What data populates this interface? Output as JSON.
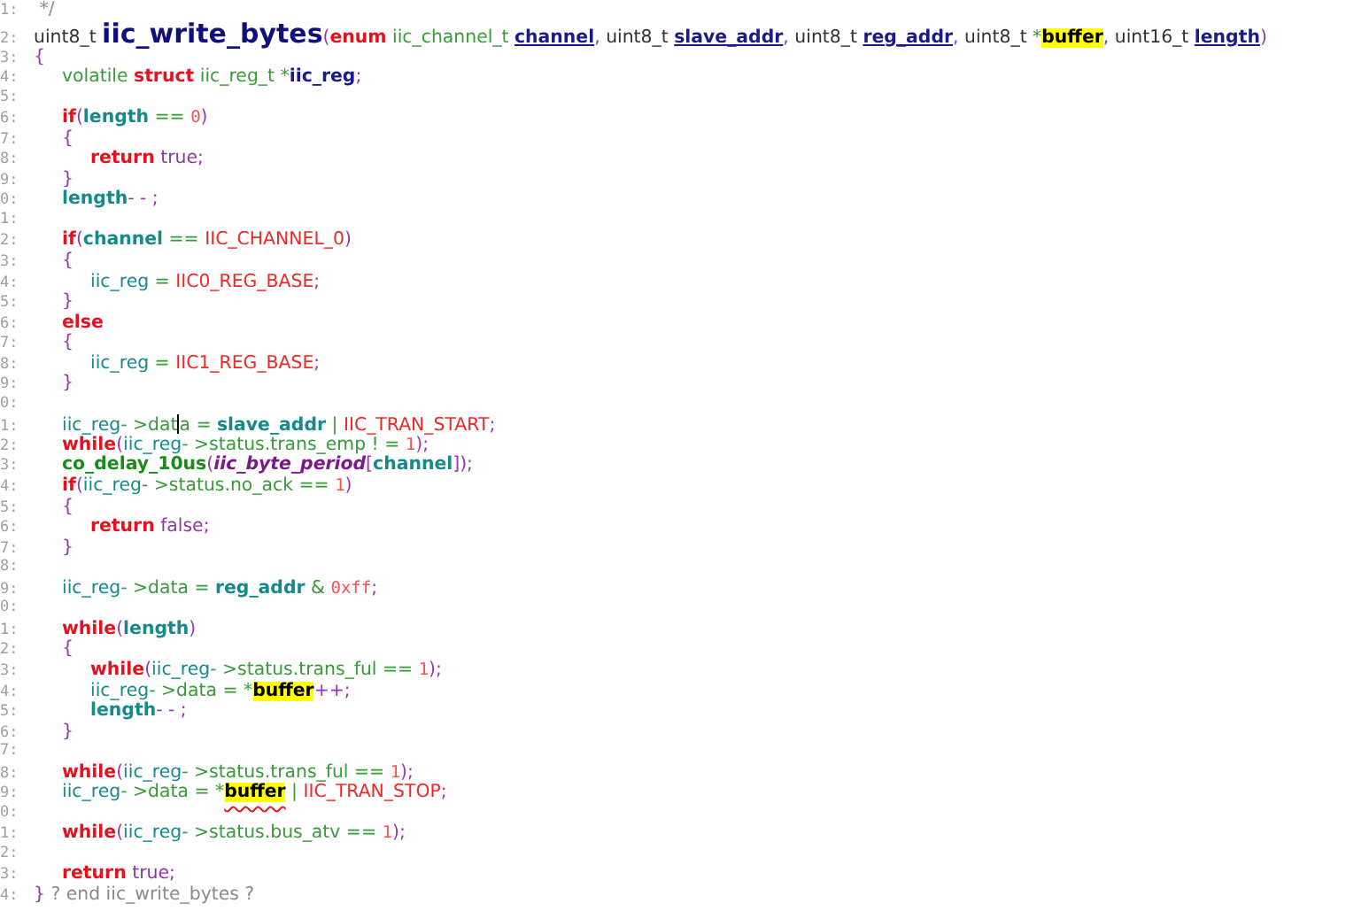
{
  "editor": {
    "lines": [
      {
        "number": "1:",
        "tokens": [
          {
            "kind": "comment",
            "text": " */"
          }
        ]
      },
      {
        "number": "2:",
        "tokens": [
          {
            "kind": "plain",
            "text": "uint8_t "
          },
          {
            "kind": "fn",
            "text": "iic_write_bytes"
          },
          {
            "kind": "punct",
            "text": "("
          },
          {
            "kind": "kw",
            "text": "enum"
          },
          {
            "kind": "type",
            "text": " iic_channel_t "
          },
          {
            "kind": "param",
            "text": "channel"
          },
          {
            "kind": "punct",
            "text": ", "
          },
          {
            "kind": "plain",
            "text": "uint8_t "
          },
          {
            "kind": "param",
            "text": "slave_addr"
          },
          {
            "kind": "punct",
            "text": ", "
          },
          {
            "kind": "plain",
            "text": "uint8_t "
          },
          {
            "kind": "param",
            "text": "reg_addr"
          },
          {
            "kind": "punct",
            "text": ", "
          },
          {
            "kind": "plain",
            "text": "uint8_t "
          },
          {
            "kind": "op",
            "text": "*"
          },
          {
            "kind": "hl",
            "text": "buffer"
          },
          {
            "kind": "punct",
            "text": ", "
          },
          {
            "kind": "plain",
            "text": "uint16_t "
          },
          {
            "kind": "param",
            "text": "length"
          },
          {
            "kind": "punct",
            "text": ")"
          }
        ]
      },
      {
        "number": "3:",
        "tokens": [
          {
            "kind": "punct",
            "text": "{"
          }
        ],
        "children": [
          {
            "number": "4:",
            "tokens": [
              {
                "kind": "type",
                "text": "volatile "
              },
              {
                "kind": "kw",
                "text": "struct"
              },
              {
                "kind": "type",
                "text": " iic_reg_t "
              },
              {
                "kind": "op",
                "text": "*"
              },
              {
                "kind": "decl",
                "text": "iic_reg"
              },
              {
                "kind": "punct",
                "text": ";"
              }
            ]
          },
          {
            "number": "5:"
          },
          {
            "number": "6:",
            "tokens": [
              {
                "kind": "kw",
                "text": "if"
              },
              {
                "kind": "punct",
                "text": "("
              },
              {
                "kind": "varb",
                "text": "length"
              },
              {
                "kind": "op",
                "text": " == "
              },
              {
                "kind": "num",
                "text": "0"
              },
              {
                "kind": "punct",
                "text": ")"
              }
            ]
          },
          {
            "number": "7:",
            "tokens": [
              {
                "kind": "punct",
                "text": "{"
              }
            ],
            "children": [
              {
                "number": "8:",
                "tokens": [
                  {
                    "kind": "kw",
                    "text": "return"
                  },
                  {
                    "kind": "bool",
                    "text": " true"
                  },
                  {
                    "kind": "punct",
                    "text": ";"
                  }
                ]
              }
            ]
          },
          {
            "number": "9:",
            "tokens": [
              {
                "kind": "punct",
                "text": "}"
              }
            ]
          },
          {
            "number": "0:",
            "tokens": [
              {
                "kind": "varb",
                "text": "length"
              },
              {
                "kind": "punct",
                "text": "- - ;"
              }
            ]
          },
          {
            "number": "1:"
          },
          {
            "number": "2:",
            "tokens": [
              {
                "kind": "kw",
                "text": "if"
              },
              {
                "kind": "punct",
                "text": "("
              },
              {
                "kind": "varb",
                "text": "channel"
              },
              {
                "kind": "op",
                "text": " == "
              },
              {
                "kind": "const",
                "text": "IIC_CHANNEL_0"
              },
              {
                "kind": "punct",
                "text": ")"
              }
            ]
          },
          {
            "number": "3:",
            "tokens": [
              {
                "kind": "punct",
                "text": "{"
              }
            ],
            "children": [
              {
                "number": "4:",
                "tokens": [
                  {
                    "kind": "var",
                    "text": "iic_reg"
                  },
                  {
                    "kind": "op",
                    "text": " = "
                  },
                  {
                    "kind": "const",
                    "text": "IIC0_REG_BASE"
                  },
                  {
                    "kind": "punct",
                    "text": ";"
                  }
                ]
              }
            ]
          },
          {
            "number": "5:",
            "tokens": [
              {
                "kind": "punct",
                "text": "}"
              }
            ]
          },
          {
            "number": "6:",
            "tokens": [
              {
                "kind": "kw",
                "text": "else"
              }
            ]
          },
          {
            "number": "7:",
            "tokens": [
              {
                "kind": "punct",
                "text": "{"
              }
            ],
            "children": [
              {
                "number": "8:",
                "tokens": [
                  {
                    "kind": "var",
                    "text": "iic_reg"
                  },
                  {
                    "kind": "op",
                    "text": " = "
                  },
                  {
                    "kind": "const",
                    "text": "IIC1_REG_BASE"
                  },
                  {
                    "kind": "punct",
                    "text": ";"
                  }
                ]
              }
            ]
          },
          {
            "number": "9:",
            "tokens": [
              {
                "kind": "punct",
                "text": "}"
              }
            ]
          },
          {
            "number": "0:"
          },
          {
            "number": "1:",
            "tokens": [
              {
                "kind": "var",
                "text": "iic_reg"
              },
              {
                "kind": "op",
                "text": "- >dat"
              },
              {
                "kind": "caret"
              },
              {
                "kind": "op",
                "text": "a = "
              },
              {
                "kind": "varb",
                "text": "slave_addr"
              },
              {
                "kind": "op",
                "text": " | "
              },
              {
                "kind": "const",
                "text": "IIC_TRAN_START"
              },
              {
                "kind": "punct",
                "text": ";"
              }
            ]
          },
          {
            "number": "2:",
            "tokens": [
              {
                "kind": "kw",
                "text": "while"
              },
              {
                "kind": "punct",
                "text": "("
              },
              {
                "kind": "var",
                "text": "iic_reg"
              },
              {
                "kind": "op",
                "text": "- >status.trans_emp ! = "
              },
              {
                "kind": "num",
                "text": "1"
              },
              {
                "kind": "punct",
                "text": ");"
              }
            ]
          },
          {
            "number": "3:",
            "tokens": [
              {
                "kind": "call",
                "text": "co_delay_10us"
              },
              {
                "kind": "punct",
                "text": "("
              },
              {
                "kind": "italic",
                "text": "iic_byte_period"
              },
              {
                "kind": "punct",
                "text": "["
              },
              {
                "kind": "varb",
                "text": "channel"
              },
              {
                "kind": "punct",
                "text": "]);"
              }
            ]
          },
          {
            "number": "4:",
            "tokens": [
              {
                "kind": "kw",
                "text": "if"
              },
              {
                "kind": "punct",
                "text": "("
              },
              {
                "kind": "var",
                "text": "iic_reg"
              },
              {
                "kind": "op",
                "text": "- >status.no_ack == "
              },
              {
                "kind": "num",
                "text": "1"
              },
              {
                "kind": "punct",
                "text": ")"
              }
            ]
          },
          {
            "number": "5:",
            "tokens": [
              {
                "kind": "punct",
                "text": "{"
              }
            ],
            "children": [
              {
                "number": "6:",
                "tokens": [
                  {
                    "kind": "kw",
                    "text": "return"
                  },
                  {
                    "kind": "bool",
                    "text": " false"
                  },
                  {
                    "kind": "punct",
                    "text": ";"
                  }
                ]
              }
            ]
          },
          {
            "number": "7:",
            "tokens": [
              {
                "kind": "punct",
                "text": "}"
              }
            ]
          },
          {
            "number": "8:"
          },
          {
            "number": "9:",
            "tokens": [
              {
                "kind": "var",
                "text": "iic_reg"
              },
              {
                "kind": "op",
                "text": "- >data = "
              },
              {
                "kind": "varb",
                "text": "reg_addr"
              },
              {
                "kind": "op",
                "text": " & "
              },
              {
                "kind": "num",
                "text": "0xff"
              },
              {
                "kind": "punct",
                "text": ";"
              }
            ]
          },
          {
            "number": "0:"
          },
          {
            "number": "1:",
            "tokens": [
              {
                "kind": "kw",
                "text": "while"
              },
              {
                "kind": "punct",
                "text": "("
              },
              {
                "kind": "varb",
                "text": "length"
              },
              {
                "kind": "punct",
                "text": ")"
              }
            ]
          },
          {
            "number": "2:",
            "tokens": [
              {
                "kind": "punct",
                "text": "{"
              }
            ],
            "children": [
              {
                "number": "3:",
                "tokens": [
                  {
                    "kind": "kw",
                    "text": "while"
                  },
                  {
                    "kind": "punct",
                    "text": "("
                  },
                  {
                    "kind": "var",
                    "text": "iic_reg"
                  },
                  {
                    "kind": "op",
                    "text": "- >status.trans_ful == "
                  },
                  {
                    "kind": "num",
                    "text": "1"
                  },
                  {
                    "kind": "punct",
                    "text": ");"
                  }
                ]
              },
              {
                "number": "4:",
                "tokens": [
                  {
                    "kind": "var",
                    "text": "iic_reg"
                  },
                  {
                    "kind": "op",
                    "text": "- >data = *"
                  },
                  {
                    "kind": "hl",
                    "text": "buffer"
                  },
                  {
                    "kind": "punct",
                    "text": "++;"
                  }
                ]
              },
              {
                "number": "5:",
                "tokens": [
                  {
                    "kind": "varb",
                    "text": "length"
                  },
                  {
                    "kind": "punct",
                    "text": "- - ;"
                  }
                ]
              }
            ]
          },
          {
            "number": "6:",
            "tokens": [
              {
                "kind": "punct",
                "text": "}"
              }
            ]
          },
          {
            "number": "7:"
          },
          {
            "number": "8:",
            "tokens": [
              {
                "kind": "kw",
                "text": "while"
              },
              {
                "kind": "punct",
                "text": "("
              },
              {
                "kind": "var",
                "text": "iic_reg"
              },
              {
                "kind": "op",
                "text": "- >status.trans_ful == "
              },
              {
                "kind": "num",
                "text": "1"
              },
              {
                "kind": "punct",
                "text": ");"
              }
            ]
          },
          {
            "number": "9:",
            "tokens": [
              {
                "kind": "var",
                "text": "iic_reg"
              },
              {
                "kind": "op",
                "text": "- >data = *"
              },
              {
                "kind": "hl-squiggle",
                "text": "buffer"
              },
              {
                "kind": "op",
                "text": " | "
              },
              {
                "kind": "const",
                "text": "IIC_TRAN_STOP"
              },
              {
                "kind": "punct",
                "text": ";"
              }
            ]
          },
          {
            "number": "0:"
          },
          {
            "number": "1:",
            "tokens": [
              {
                "kind": "kw",
                "text": "while"
              },
              {
                "kind": "punct",
                "text": "("
              },
              {
                "kind": "var",
                "text": "iic_reg"
              },
              {
                "kind": "op",
                "text": "- >status.bus_atv == "
              },
              {
                "kind": "num",
                "text": "1"
              },
              {
                "kind": "punct",
                "text": ");"
              }
            ]
          },
          {
            "number": "2:"
          },
          {
            "number": "3:",
            "tokens": [
              {
                "kind": "kw",
                "text": "return"
              },
              {
                "kind": "bool",
                "text": " true"
              },
              {
                "kind": "punct",
                "text": ";"
              }
            ]
          }
        ]
      },
      {
        "number": "4:",
        "tokens": [
          {
            "kind": "punct",
            "text": "}"
          },
          {
            "kind": "comment",
            "text": " ? end iic_write_bytes ?"
          }
        ]
      }
    ]
  }
}
